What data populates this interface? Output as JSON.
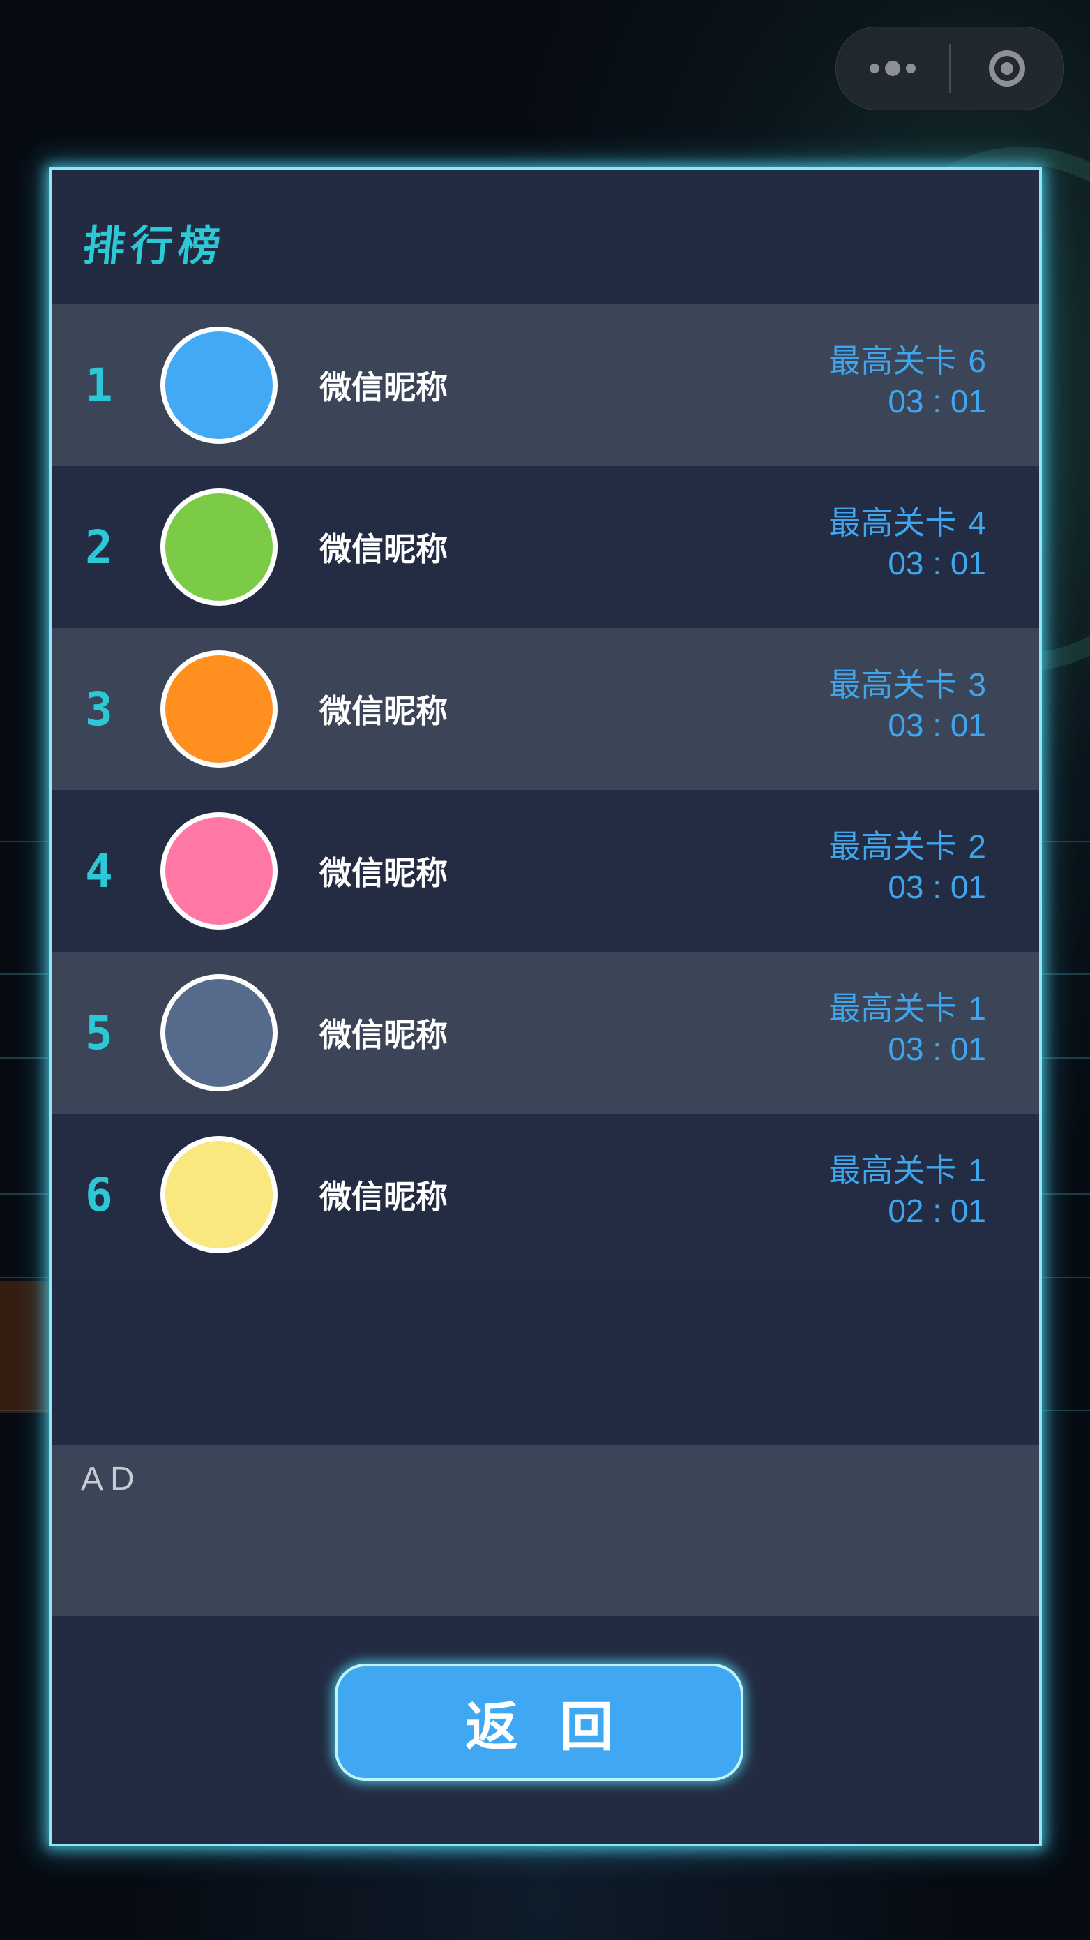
{
  "capsule": {
    "more_icon": "more-dots-icon",
    "close_icon": "target-close-icon"
  },
  "leaderboard": {
    "title": "排行榜",
    "level_prefix": "最高关卡",
    "rows": [
      {
        "rank": "1",
        "nickname": "微信昵称",
        "level": "6",
        "time": "03 : 01",
        "avatar_color": "#42a9f4"
      },
      {
        "rank": "2",
        "nickname": "微信昵称",
        "level": "4",
        "time": "03 : 01",
        "avatar_color": "#7ccb46"
      },
      {
        "rank": "3",
        "nickname": "微信昵称",
        "level": "3",
        "time": "03 : 01",
        "avatar_color": "#ff8f1f"
      },
      {
        "rank": "4",
        "nickname": "微信昵称",
        "level": "2",
        "time": "03 : 01",
        "avatar_color": "#ff78a5"
      },
      {
        "rank": "5",
        "nickname": "微信昵称",
        "level": "1",
        "time": "03 : 01",
        "avatar_color": "#566a8b"
      },
      {
        "rank": "6",
        "nickname": "微信昵称",
        "level": "1",
        "time": "02 : 01",
        "avatar_color": "#f9e87f"
      }
    ]
  },
  "ad": {
    "label": "AD"
  },
  "footer": {
    "back_label": "返回"
  },
  "colors": {
    "accent_cyan": "#2cc8d6",
    "score_blue": "#3fa5ec",
    "panel_border": "#8ae9f3",
    "button_blue": "#40a8f2"
  }
}
